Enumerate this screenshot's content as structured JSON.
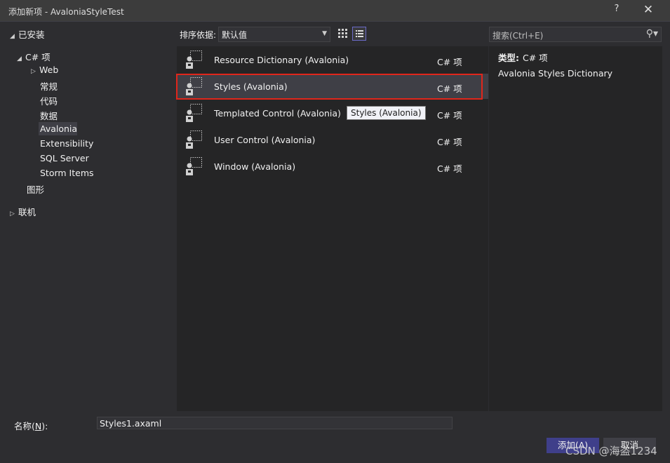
{
  "window": {
    "title": "添加新项 - AvaloniaStyleTest",
    "help_label": "?",
    "close_label": "✕"
  },
  "tree": {
    "installed": "已安装",
    "csharp": "C# 项",
    "web": "Web",
    "general": "常规",
    "code": "代码",
    "data": "数据",
    "avalonia": "Avalonia",
    "extensibility": "Extensibility",
    "sqlserver": "SQL Server",
    "stormitems": "Storm Items",
    "graphics": "图形",
    "online": "联机"
  },
  "toolbar": {
    "sort_label": "排序依据:",
    "sort_value": "默认值",
    "search_placeholder": "搜索(Ctrl+E)"
  },
  "templates": [
    {
      "name": "Resource Dictionary (Avalonia)",
      "lang": "C# 项"
    },
    {
      "name": "Styles (Avalonia)",
      "lang": "C# 项"
    },
    {
      "name": "Templated Control (Avalonia)",
      "lang": "C# 项"
    },
    {
      "name": "User Control (Avalonia)",
      "lang": "C# 项"
    },
    {
      "name": "Window (Avalonia)",
      "lang": "C# 项"
    }
  ],
  "tooltip": "Styles (Avalonia)",
  "details": {
    "type_label": "类型:",
    "type_value": "C# 项",
    "description": "Avalonia Styles Dictionary"
  },
  "name_row": {
    "label_prefix": "名称(",
    "label_key": "N",
    "label_suffix": "):",
    "value": "Styles1.axaml"
  },
  "buttons": {
    "add": "添加(A)",
    "cancel": "取消"
  },
  "watermark": "CSDN @海盗1234",
  "colors": {
    "accent": "#3f3f8a",
    "highlight_border": "#e0261b",
    "background": "#2d2d30"
  }
}
